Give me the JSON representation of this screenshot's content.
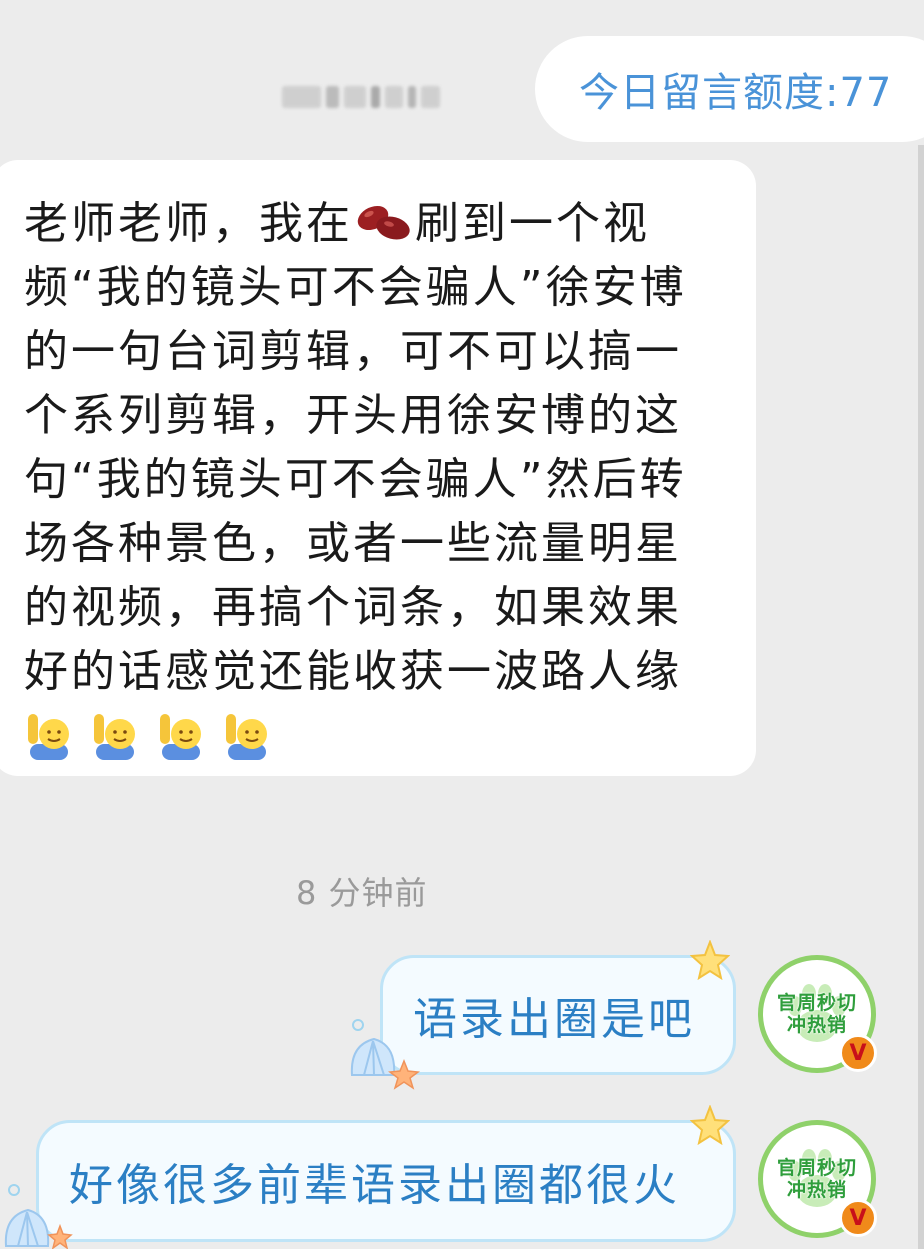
{
  "header": {
    "quota_label": "今日留言额度:77"
  },
  "incoming_message": {
    "text_before_icon": "老师老师，我在",
    "icon": "red-bean-icon",
    "text_after_icon": "刷到一个视频“我的镜头可不会骗人”徐安博的一句台词剪辑，可不可以搞一个系列剪辑，开头用徐安博的这句“我的镜头可不会骗人”然后转场各种景色，或者一些流量明星的视频，再搞个词条，如果效果好的话感觉还能收获一波路人缘",
    "trailing_emojis": [
      "raising-hand-emoji",
      "raising-hand-emoji",
      "raising-hand-emoji",
      "raising-hand-emoji"
    ]
  },
  "timestamp": "8 分钟前",
  "outgoing_messages": [
    {
      "text": "语录出圈是吧"
    },
    {
      "text": "好像很多前辈语录出圈都很火"
    }
  ],
  "avatar": {
    "line1": "官周秒切",
    "line2": "冲热销",
    "badge": "V",
    "ring_color": "#8fd16a",
    "text_color": "#2f9e3c"
  },
  "colors": {
    "background": "#ececec",
    "quota_text": "#4a93d8",
    "outgoing_text": "#2b7fc4",
    "outgoing_border": "#bfe4f7"
  }
}
